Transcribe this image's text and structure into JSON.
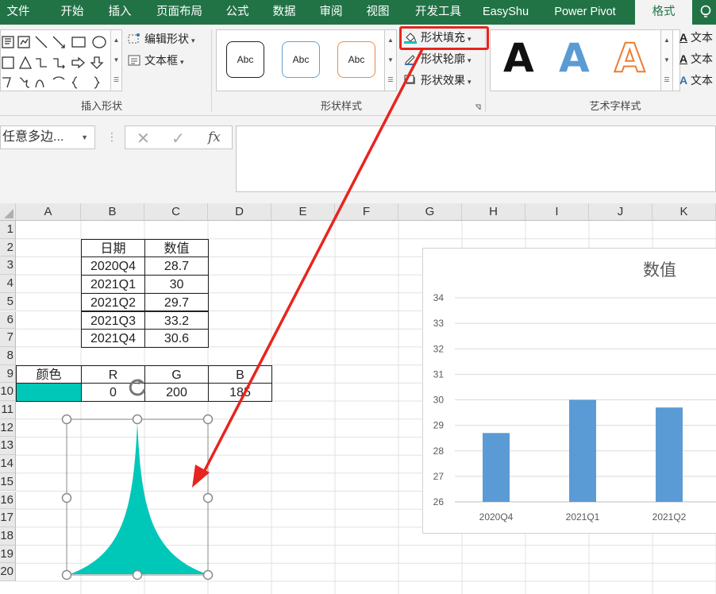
{
  "tabs": [
    "文件",
    "开始",
    "插入",
    "页面布局",
    "公式",
    "数据",
    "审阅",
    "视图",
    "开发工具",
    "EasyShu",
    "Power Pivot",
    "格式"
  ],
  "ribbon": {
    "insert_shapes": {
      "edit_shape": "编辑形状",
      "text_box": "文本框",
      "label": "插入形状"
    },
    "shape_styles": {
      "presets": [
        "Abc",
        "Abc",
        "Abc"
      ],
      "fill": "形状填充",
      "outline": "形状轮廓",
      "effects": "形状效果",
      "label": "形状样式"
    },
    "wordart": {
      "letters": [
        "A",
        "A",
        "A"
      ],
      "text_items": [
        "文本",
        "文本",
        "文本"
      ],
      "label": "艺术字样式"
    }
  },
  "formula_bar": {
    "name_box": "任意多边...",
    "fx": "fx",
    "formula": ""
  },
  "columns": [
    "A",
    "B",
    "C",
    "D",
    "E",
    "F",
    "G",
    "H",
    "I",
    "J",
    "K"
  ],
  "rows": [
    "1",
    "2",
    "3",
    "4",
    "5",
    "6",
    "7",
    "8",
    "9",
    "10",
    "11",
    "12",
    "13",
    "14",
    "15",
    "16",
    "17",
    "18",
    "19",
    "20"
  ],
  "table": {
    "headers": [
      "日期",
      "数值"
    ],
    "rows": [
      [
        "2020Q4",
        "28.7"
      ],
      [
        "2021Q1",
        "30"
      ],
      [
        "2021Q2",
        "29.7"
      ],
      [
        "2021Q3",
        "33.2"
      ],
      [
        "2021Q4",
        "30.6"
      ]
    ]
  },
  "color_table": {
    "headers": [
      "颜色",
      "R",
      "G",
      "B"
    ],
    "values": [
      "0",
      "200",
      "185"
    ],
    "swatch": "#00c8b9"
  },
  "shape_color": "#00c8b9",
  "chart_data": {
    "type": "bar",
    "title": "数值",
    "categories": [
      "2020Q4",
      "2021Q1",
      "2021Q2"
    ],
    "values": [
      28.7,
      30,
      29.7
    ],
    "ylim": [
      26,
      34
    ],
    "yticks": [
      "26",
      "27",
      "28",
      "29",
      "30",
      "31",
      "32",
      "33",
      "34"
    ],
    "bar_color": "#5b9bd5",
    "grid": true
  },
  "colors": {
    "accent": "#217346",
    "highlight": "#e8241e"
  }
}
